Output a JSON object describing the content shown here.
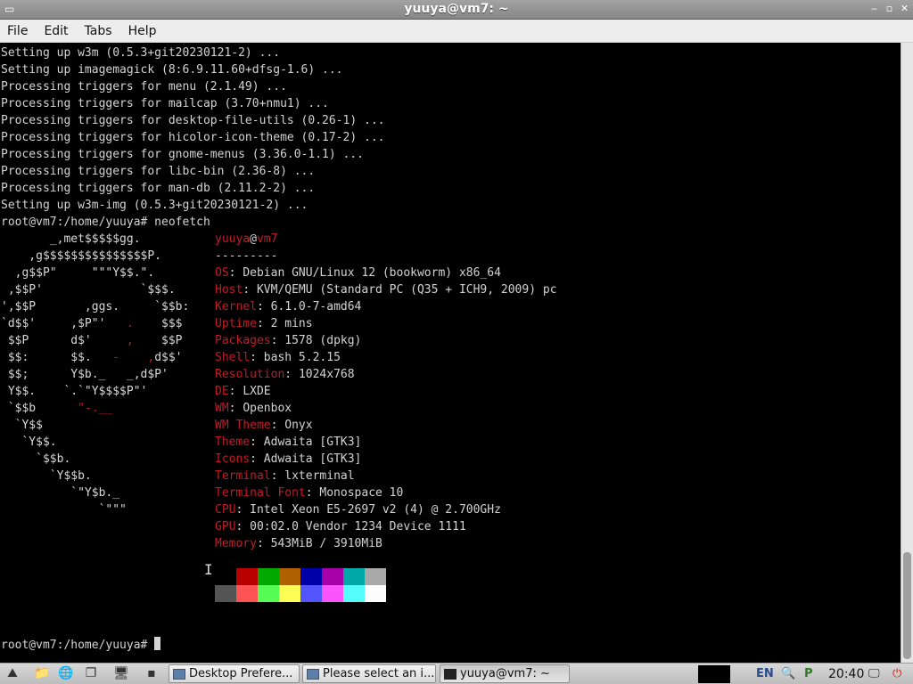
{
  "window": {
    "title": "yuuya@vm7: ~",
    "minimize": "‒",
    "restore": "▫",
    "close": "✕"
  },
  "menu": [
    "File",
    "Edit",
    "Tabs",
    "Help"
  ],
  "output_lines": [
    "Setting up w3m (0.5.3+git20230121-2) ...",
    "Setting up imagemagick (8:6.9.11.60+dfsg-1.6) ...",
    "Processing triggers for menu (2.1.49) ...",
    "Processing triggers for mailcap (3.70+nmu1) ...",
    "Processing triggers for desktop-file-utils (0.26-1) ...",
    "Processing triggers for hicolor-icon-theme (0.17-2) ...",
    "Processing triggers for gnome-menus (3.36.0-1.1) ...",
    "Processing triggers for libc-bin (2.36-8) ...",
    "Processing triggers for man-db (2.11.2-2) ...",
    "Setting up w3m-img (0.5.3+git20230121-2) ..."
  ],
  "command_line": "root@vm7:/home/yuuya# neofetch",
  "logo_lines": [
    "       _,met$$$$$gg.",
    "    ,g$$$$$$$$$$$$$$$P.",
    "  ,g$$P\"     \"\"\"Y$$.\".",
    " ,$$P'              `$$$.",
    "',$$P       ,ggs.     `$$b:",
    "`d$$'     ,$P\"'   .    $$$",
    " $$P      d$'     ,    $$P",
    " $$:      $$.   -    ,d$$'",
    " $$;      Y$b._   _,d$P'",
    " Y$$.    `.`\"Y$$$$P\"'",
    " `$$b      \"-.__",
    "  `Y$$",
    "   `Y$$.",
    "     `$$b.",
    "       `Y$$b.",
    "          `\"Y$b._",
    "              `\"\"\""
  ],
  "neofetch": {
    "user": "yuuya",
    "at": "@",
    "host": "vm7",
    "separator": "---------",
    "info": [
      {
        "key": "OS",
        "value": "Debian GNU/Linux 12 (bookworm) x86_64"
      },
      {
        "key": "Host",
        "value": "KVM/QEMU (Standard PC (Q35 + ICH9, 2009) pc"
      },
      {
        "key": "Kernel",
        "value": "6.1.0-7-amd64"
      },
      {
        "key": "Uptime",
        "value": "2 mins"
      },
      {
        "key": "Packages",
        "value": "1578 (dpkg)"
      },
      {
        "key": "Shell",
        "value": "bash 5.2.15"
      },
      {
        "key": "Resolution",
        "value": "1024x768"
      },
      {
        "key": "DE",
        "value": "LXDE"
      },
      {
        "key": "WM",
        "value": "Openbox"
      },
      {
        "key": "WM Theme",
        "value": "Onyx"
      },
      {
        "key": "Theme",
        "value": "Adwaita [GTK3]"
      },
      {
        "key": "Icons",
        "value": "Adwaita [GTK3]"
      },
      {
        "key": "Terminal",
        "value": "lxterminal"
      },
      {
        "key": "Terminal Font",
        "value": "Monospace 10"
      },
      {
        "key": "CPU",
        "value": "Intel Xeon E5-2697 v2 (4) @ 2.700GHz"
      },
      {
        "key": "GPU",
        "value": "00:02.0 Vendor 1234 Device 1111"
      },
      {
        "key": "Memory",
        "value": "543MiB / 3910MiB"
      }
    ],
    "palette_top": [
      "#000000",
      "#b80000",
      "#00a800",
      "#b06000",
      "#0000a8",
      "#a800a8",
      "#00a8a8",
      "#a8a8a8"
    ],
    "palette_bottom": [
      "#545454",
      "#fc5454",
      "#54fc54",
      "#fcfc54",
      "#5454fc",
      "#fc54fc",
      "#54fcfc",
      "#fcfcfc"
    ]
  },
  "prompt": "root@vm7:/home/yuuya# ",
  "colors": {
    "accent_red": "#c01c28",
    "text": "#d3d3d3"
  },
  "taskbar": {
    "tasks": [
      {
        "label": "Desktop Prefere...",
        "icon": "window-icon"
      },
      {
        "label": "Please select an i...",
        "icon": "window-icon"
      },
      {
        "label": "yuuya@vm7: ~",
        "icon": "terminal-icon"
      }
    ],
    "language": "EN",
    "clock": "20:40"
  }
}
